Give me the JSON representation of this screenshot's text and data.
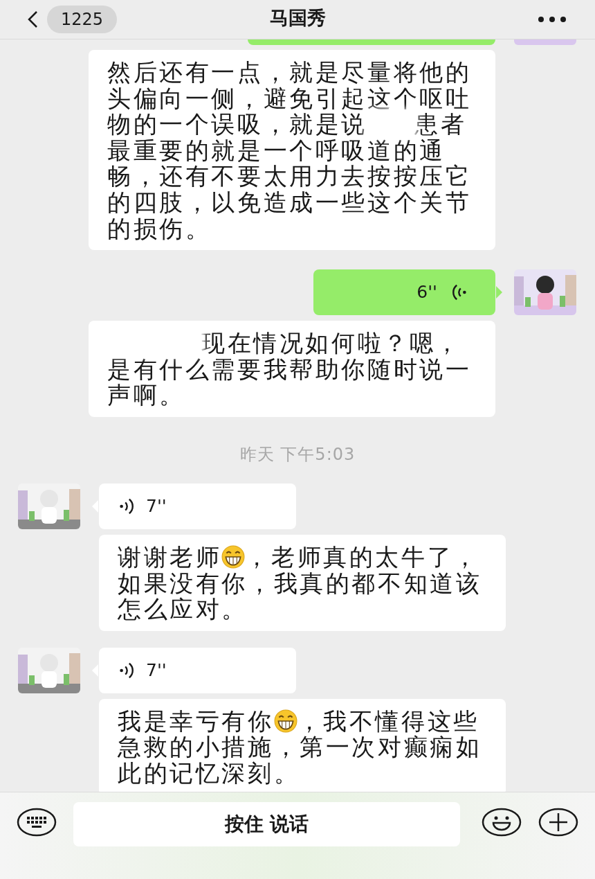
{
  "header": {
    "back_count": "1225",
    "title": "马国秀"
  },
  "messages": [
    {
      "kind": "outgoing_voice",
      "cut_top": true,
      "transcript": [
        {
          "kind": "text",
          "text": "然后还有一点，就是尽量将他的头偏向一侧，避免引起这个呕吐物的一个误吸，就是说"
        },
        {
          "kind": "blur"
        },
        {
          "kind": "blur"
        },
        {
          "kind": "text",
          "text": "患者最重要的就是一个呼吸道的通畅，还有不要太用力去按按压它的四肢，以免造成一些这个关节的损伤。"
        }
      ]
    },
    {
      "kind": "outgoing_voice",
      "cut_top": false,
      "duration": "6''",
      "transcript": [
        {
          "kind": "blur"
        },
        {
          "kind": "blur"
        },
        {
          "kind": "blur"
        },
        {
          "kind": "blur"
        },
        {
          "kind": "text",
          "text": "现在情况如何啦？嗯，是有什么需要我帮助你随时说一声啊。"
        }
      ]
    },
    {
      "kind": "time",
      "text": "昨天 下午5:03"
    },
    {
      "kind": "incoming_voice",
      "cut_top": false,
      "duration": "7''",
      "transcript": [
        {
          "kind": "text",
          "text": "谢谢老师"
        },
        {
          "kind": "emoji"
        },
        {
          "kind": "text",
          "text": "，老师真的太牛了，如果没有你，我真的都不知道该怎么应对。"
        }
      ]
    },
    {
      "kind": "incoming_voice",
      "cut_top": false,
      "duration": "7''",
      "transcript": [
        {
          "kind": "text",
          "text": "我是幸亏有你"
        },
        {
          "kind": "emoji"
        },
        {
          "kind": "text",
          "text": "，我不懂得这些急救的小措施，第一次对癫痫如此的记忆深刻。"
        }
      ]
    }
  ],
  "input": {
    "hold_to_talk": "按住 说话"
  }
}
